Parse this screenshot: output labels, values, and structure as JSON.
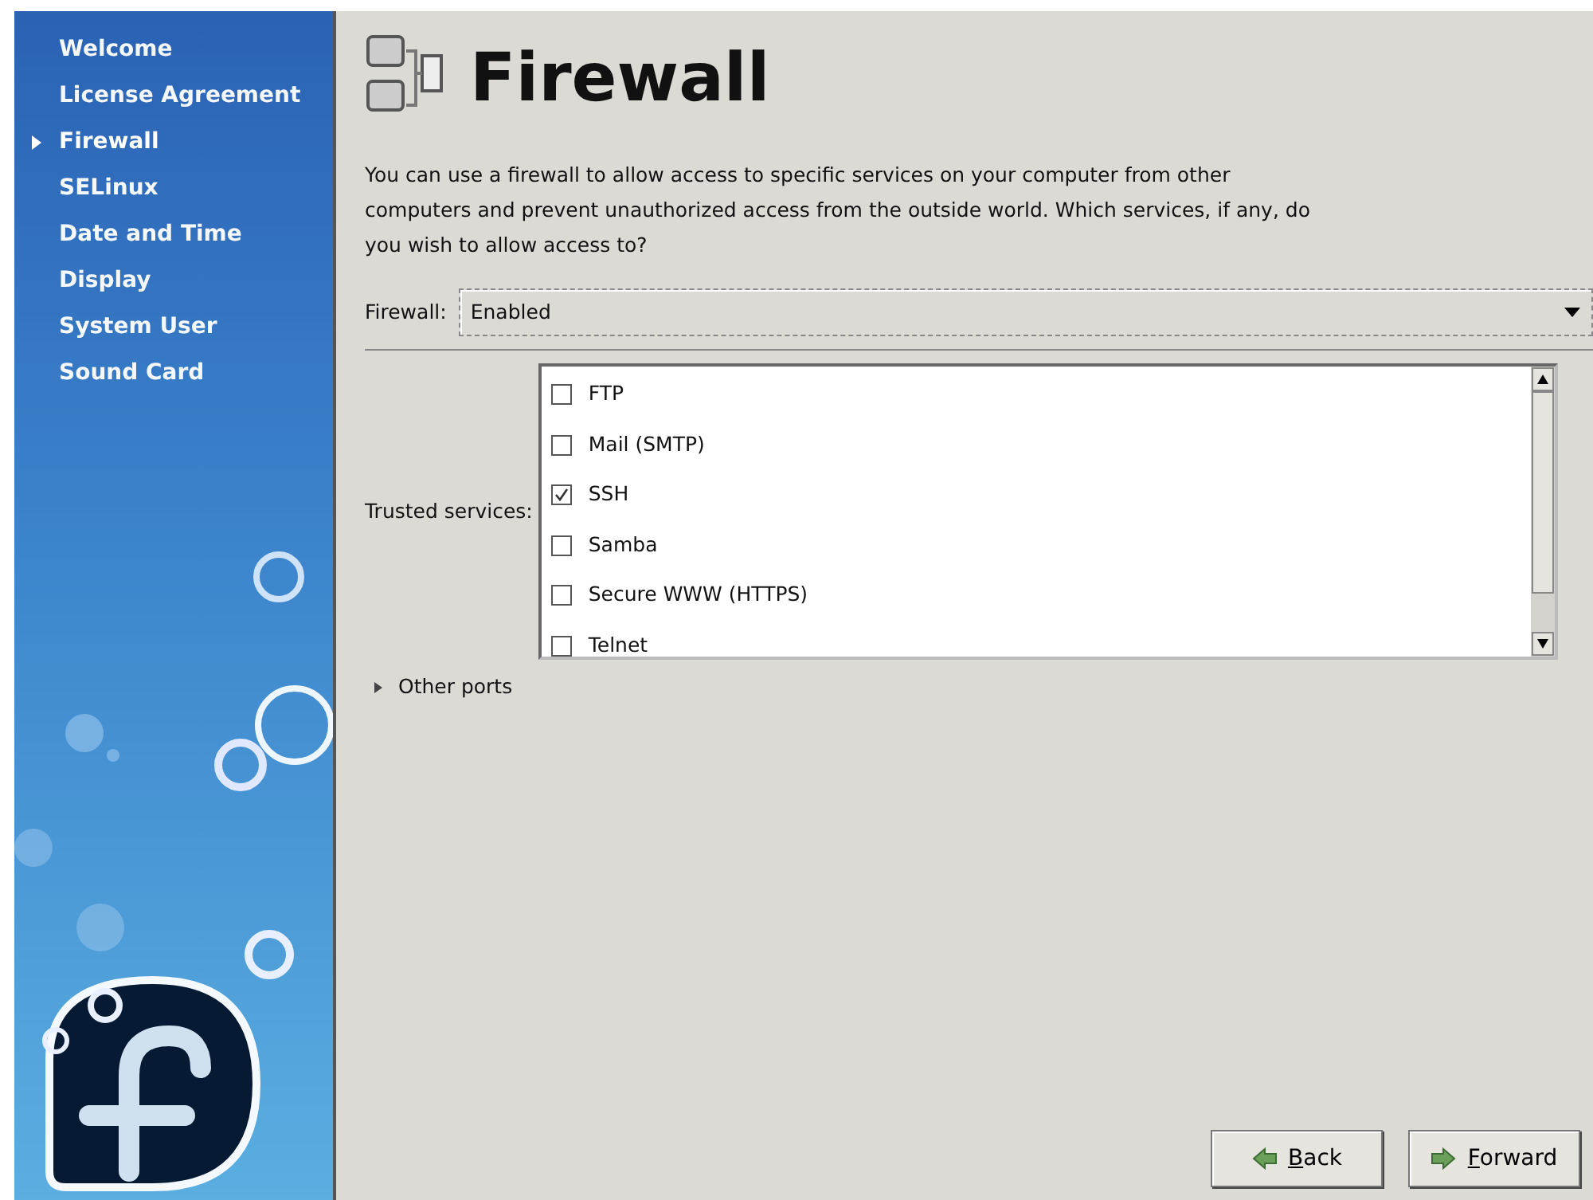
{
  "sidebar": {
    "items": [
      {
        "label": "Welcome",
        "selected": false
      },
      {
        "label": "License Agreement",
        "selected": false
      },
      {
        "label": "Firewall",
        "selected": true
      },
      {
        "label": "SELinux",
        "selected": false
      },
      {
        "label": "Date and Time",
        "selected": false
      },
      {
        "label": "Display",
        "selected": false
      },
      {
        "label": "System User",
        "selected": false
      },
      {
        "label": "Sound Card",
        "selected": false
      }
    ]
  },
  "page": {
    "title": "Firewall",
    "description": "You can use a firewall to allow access to specific services on your computer from other computers and prevent unauthorized access from the outside world.  Which services, if any, do you wish to allow access to?"
  },
  "firewall": {
    "label": "Firewall:",
    "value": "Enabled"
  },
  "trusted_services": {
    "label": "Trusted services:",
    "items": [
      {
        "label": "FTP",
        "checked": false
      },
      {
        "label": "Mail (SMTP)",
        "checked": false
      },
      {
        "label": "SSH",
        "checked": true
      },
      {
        "label": "Samba",
        "checked": false
      },
      {
        "label": "Secure WWW (HTTPS)",
        "checked": false
      },
      {
        "label": "Telnet",
        "checked": false
      }
    ]
  },
  "other_ports": {
    "label": "Other ports",
    "expanded": false
  },
  "buttons": [
    {
      "label": "Back",
      "kind": "back"
    },
    {
      "label": "Forward",
      "kind": "forward"
    }
  ]
}
